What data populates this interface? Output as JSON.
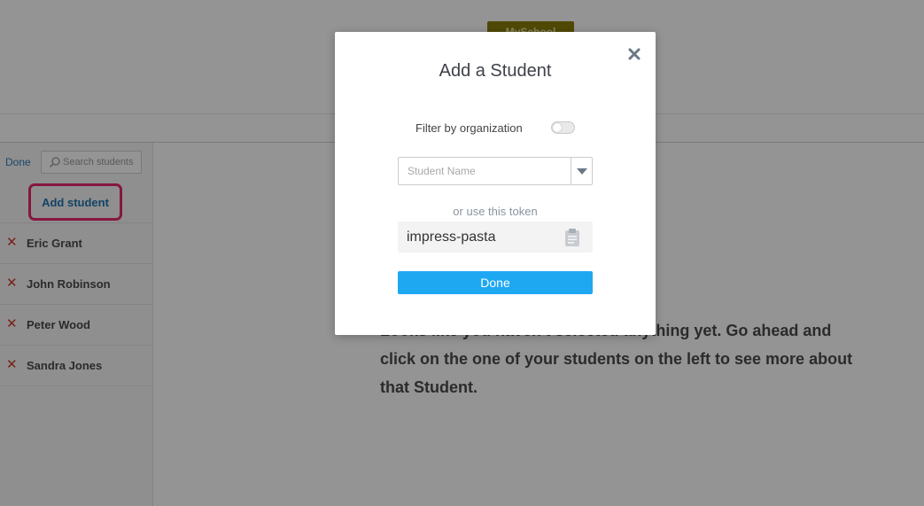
{
  "app": {
    "brand": "MySchool"
  },
  "sidebar": {
    "done_label": "Done",
    "search_placeholder": "Search students",
    "add_student_label": "Add student",
    "students": [
      {
        "name": "Eric Grant"
      },
      {
        "name": "John Robinson"
      },
      {
        "name": "Peter Wood"
      },
      {
        "name": "Sandra Jones"
      }
    ]
  },
  "main": {
    "empty_message": "Looks like you haven't selected anything yet. Go ahead and click on the one of your students on the left to see more about that Student."
  },
  "modal": {
    "title": "Add a Student",
    "filter_label": "Filter by organization",
    "filter_enabled": false,
    "student_name_placeholder": "Student Name",
    "token_label": "or use this token",
    "token_value": "impress-pasta",
    "done_label": "Done"
  },
  "colors": {
    "accent_blue": "#1ea8f2",
    "highlight_pink": "#e8266e",
    "remove_red": "#d13a2c",
    "brand_olive": "#8a7f0c"
  },
  "icons": {
    "search": "search-icon",
    "remove": "remove-icon",
    "close": "close-icon",
    "dropdown": "chevron-down-icon",
    "clipboard": "clipboard-icon"
  }
}
